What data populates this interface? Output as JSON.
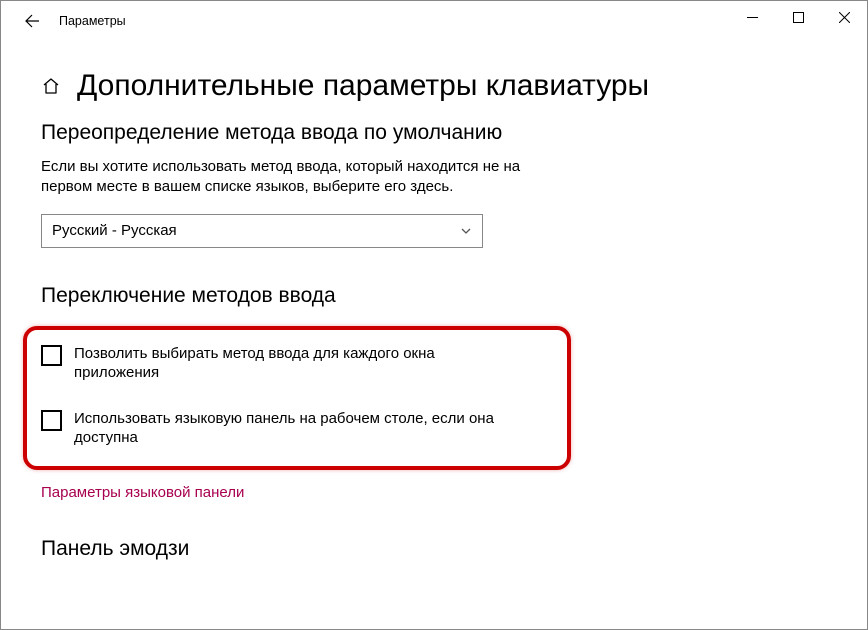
{
  "window": {
    "title": "Параметры"
  },
  "page": {
    "title": "Дополнительные параметры клавиатуры"
  },
  "section_override": {
    "title": "Переопределение метода ввода по умолчанию",
    "description": "Если вы хотите использовать метод ввода, который находится не на первом месте в вашем списке языков, выберите его здесь.",
    "dropdown_value": "Русский - Русская"
  },
  "section_switch": {
    "title": "Переключение методов ввода",
    "checkbox1_label": "Позволить выбирать метод ввода для каждого окна приложения",
    "checkbox2_label": "Использовать языковую панель на рабочем столе, если она доступна",
    "link_label": "Параметры языковой панели"
  },
  "section_emoji": {
    "title": "Панель эмодзи"
  }
}
